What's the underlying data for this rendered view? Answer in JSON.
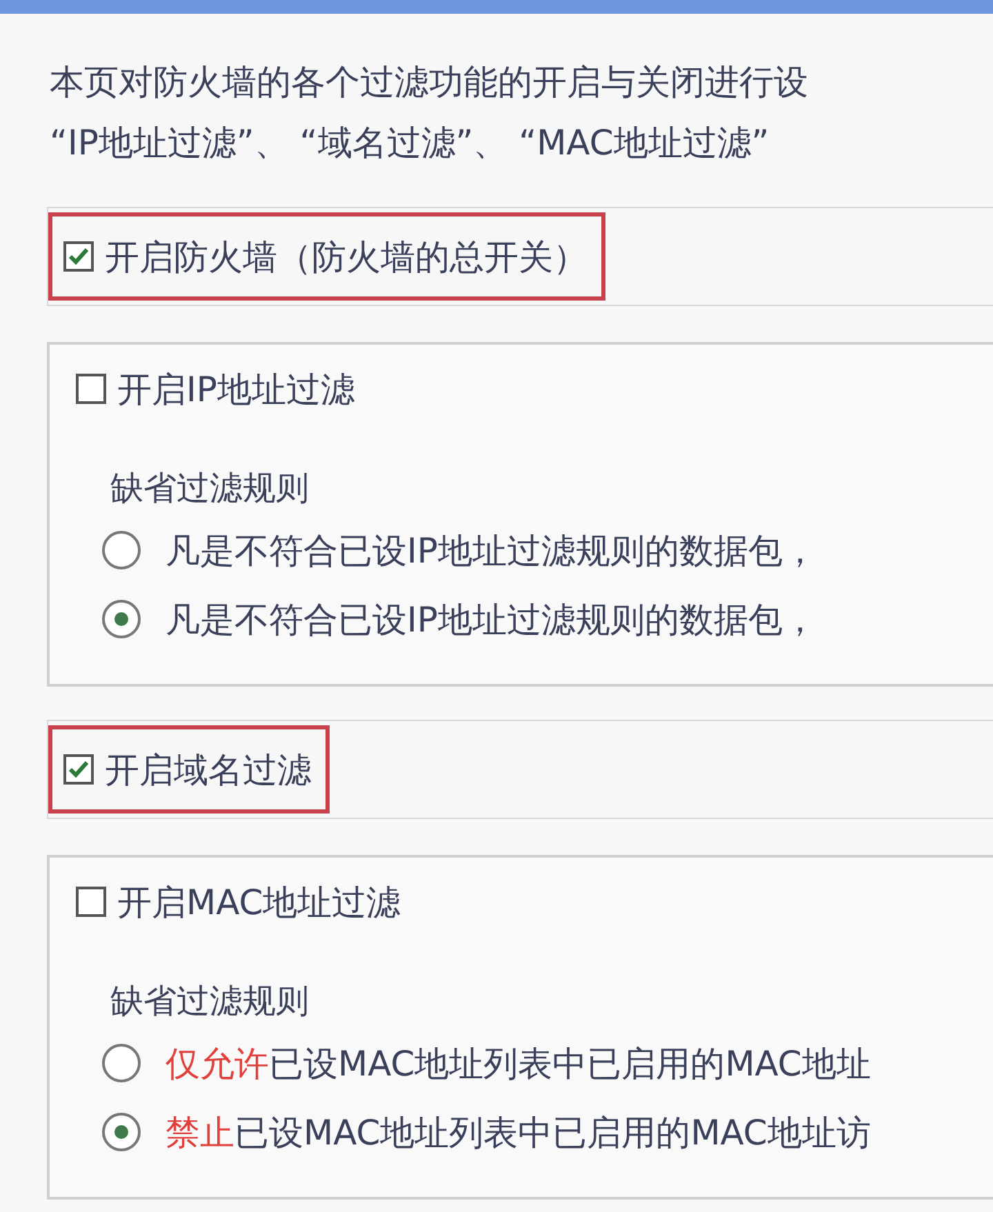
{
  "intro": [
    "本页对防火墙的各个过滤功能的开启与关闭进行设",
    "“IP地址过滤”、 “域名过滤”、 “MAC地址过滤”"
  ],
  "sections": [
    {
      "kind": "switch",
      "label": "开启防火墙",
      "note": "（防火墙的总开关）",
      "checked": true,
      "highlighted": true
    },
    {
      "kind": "group",
      "label": "开启IP地址过滤",
      "checked": false,
      "highlighted": false,
      "rule_title": "缺省过滤规则",
      "options": [
        {
          "text": "凡是不符合已设IP地址过滤规则的数据包，",
          "selected": false
        },
        {
          "text": "凡是不符合已设IP地址过滤规则的数据包，",
          "selected": true
        }
      ]
    },
    {
      "kind": "switch",
      "label": "开启域名过滤",
      "checked": true,
      "highlighted": true
    },
    {
      "kind": "group",
      "label": "开启MAC地址过滤",
      "checked": false,
      "highlighted": false,
      "rule_title": "缺省过滤规则",
      "options": [
        {
          "emphasis": "仅允许",
          "text": "已设MAC地址列表中已启用的MAC地址",
          "selected": false
        },
        {
          "emphasis": "禁止",
          "text": "已设MAC地址列表中已启用的MAC地址访",
          "selected": true
        }
      ]
    }
  ]
}
